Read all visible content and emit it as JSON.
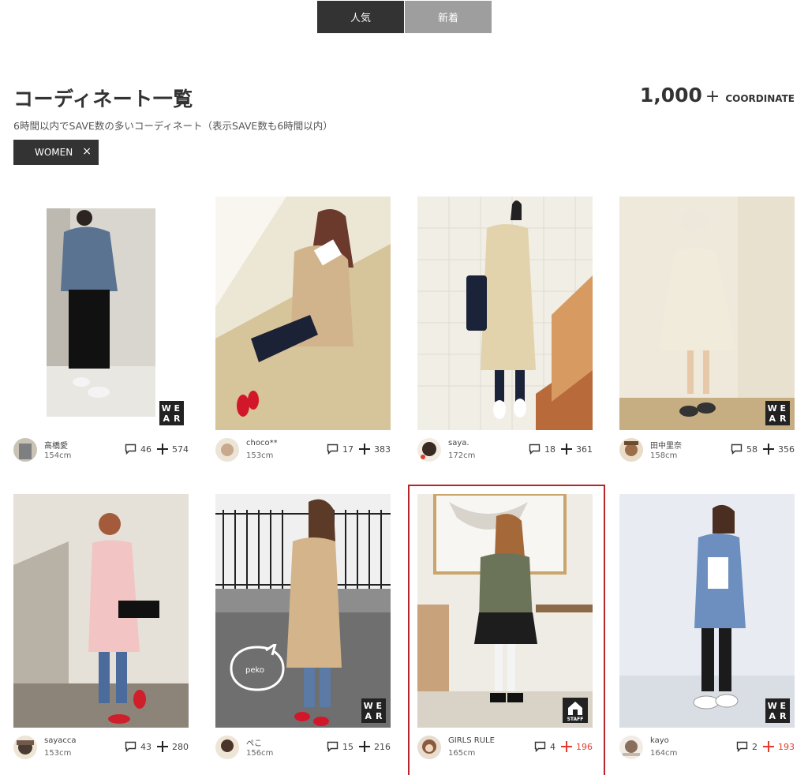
{
  "tabs": [
    {
      "label": "人気",
      "active": true
    },
    {
      "label": "新着",
      "active": false
    }
  ],
  "page_title": "コーディネート一覧",
  "count": {
    "value": "1,000",
    "plus": "+",
    "label": "COORDINATE"
  },
  "subtitle": "6時間以内でSAVE数の多いコーディネート（表示SAVE数も6時間以内）",
  "filter": {
    "label": "WOMEN",
    "remove": "×"
  },
  "badges": {
    "wear": [
      "W",
      "E",
      "A",
      "R"
    ],
    "staff": "STAFF",
    "peko": "peko"
  },
  "colors": {
    "accent_red": "#e53b2c",
    "highlight_border": "#b8252a",
    "dark": "#333333"
  },
  "cards": [
    {
      "user": "高橋愛",
      "height": "154cm",
      "comments": "46",
      "saves": "574",
      "badge": "wear",
      "highlight": false
    },
    {
      "user": "choco**",
      "height": "153cm",
      "comments": "17",
      "saves": "383",
      "badge": "none",
      "highlight": false
    },
    {
      "user": "saya.",
      "height": "172cm",
      "comments": "18",
      "saves": "361",
      "badge": "none",
      "highlight": false
    },
    {
      "user": "田中里奈",
      "height": "158cm",
      "comments": "58",
      "saves": "356",
      "badge": "wear",
      "highlight": false
    },
    {
      "user": "sayacca",
      "height": "153cm",
      "comments": "43",
      "saves": "280",
      "badge": "none",
      "highlight": false
    },
    {
      "user": "ぺこ",
      "height": "156cm",
      "comments": "15",
      "saves": "216",
      "badge": "wear",
      "highlight": false
    },
    {
      "user": "GIRLS RULE",
      "height": "165cm",
      "comments": "4",
      "saves": "196",
      "badge": "staff",
      "highlight": true
    },
    {
      "user": "kayo",
      "height": "164cm",
      "comments": "2",
      "saves": "193",
      "badge": "wear",
      "highlight": false
    }
  ]
}
